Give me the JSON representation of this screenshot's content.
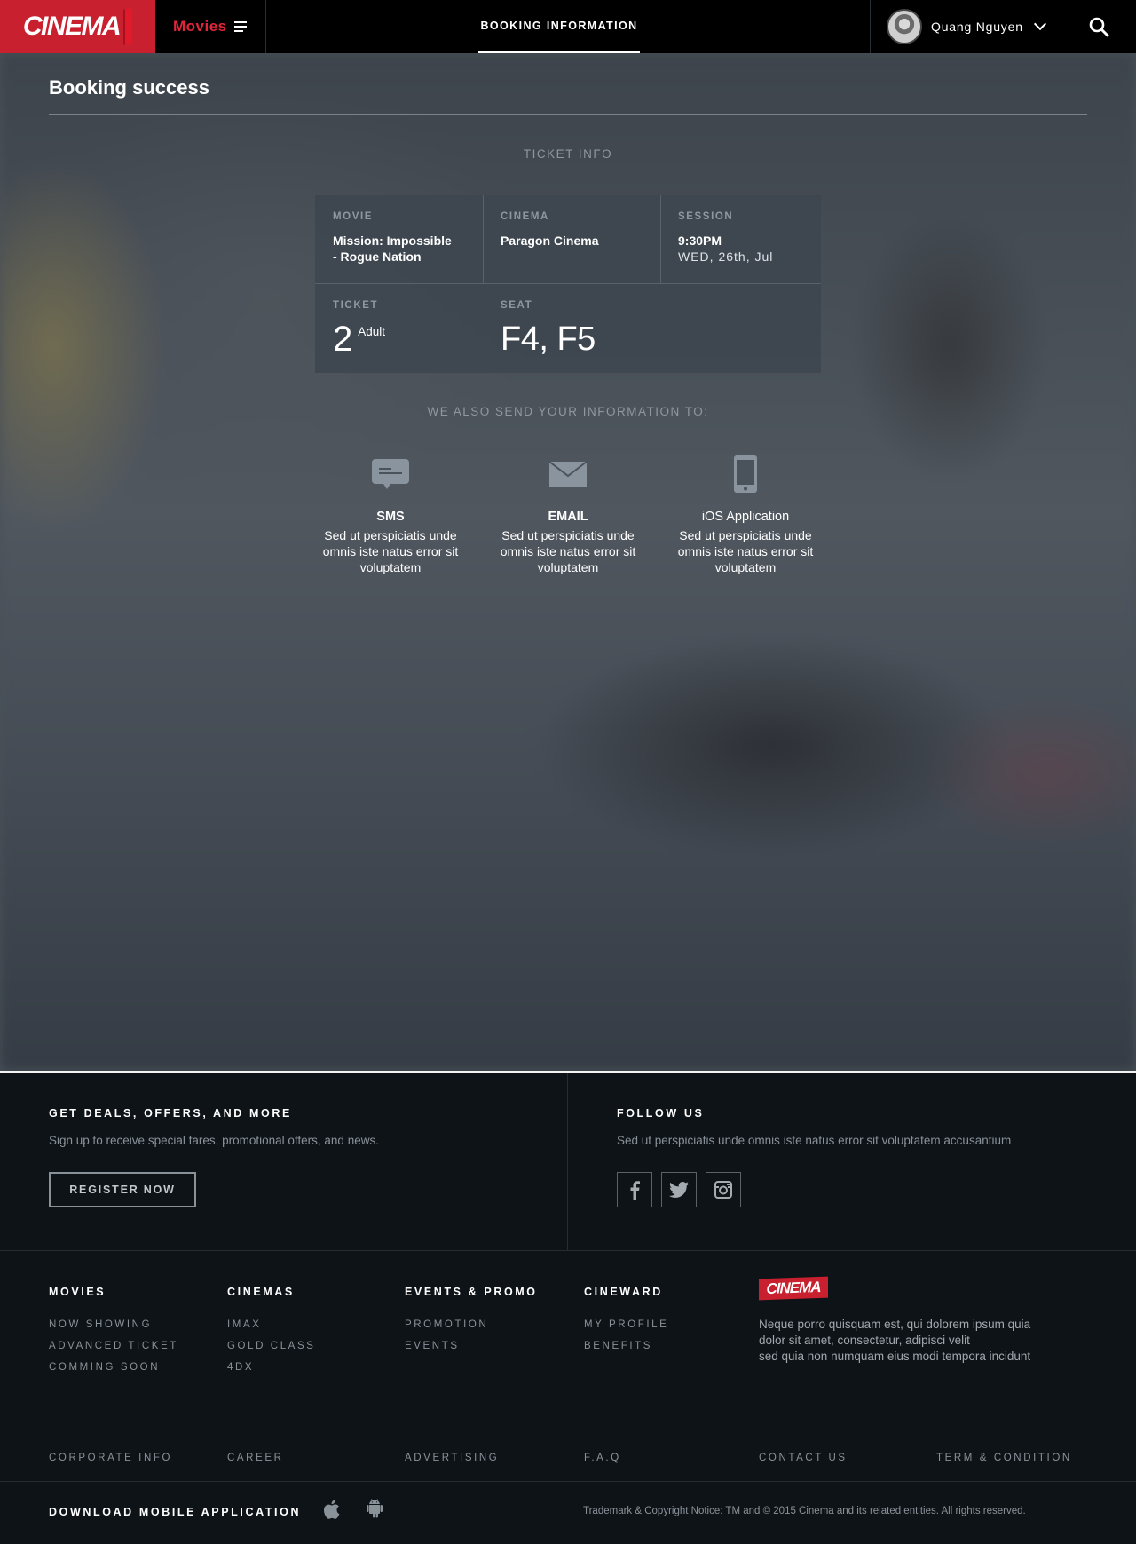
{
  "header": {
    "logo": "CINEMA",
    "menu_label": "Movies",
    "nav_tab": "BOOKING INFORMATION",
    "user_name": "Quang Nguyen"
  },
  "page": {
    "title": "Booking success",
    "ticket_info_label": "TICKET INFO",
    "also_send_label": "WE ALSO SEND YOUR INFORMATION TO:"
  },
  "ticket": {
    "movie_label": "MOVIE",
    "movie_line1": "Mission: Impossible",
    "movie_line2": "- Rogue Nation",
    "cinema_label": "CINEMA",
    "cinema_value": "Paragon Cinema",
    "session_label": "SESSION",
    "session_time": "9:30PM",
    "session_date": "WED, 26th, Jul",
    "ticket_label": "TICKET",
    "ticket_count": "2",
    "ticket_type": "Adult",
    "seat_label": "SEAT",
    "seat_value": "F4, F5"
  },
  "channels": [
    {
      "title": "SMS",
      "line1": "Sed ut perspiciatis unde",
      "line2": "omnis iste natus error sit",
      "line3": "voluptatem",
      "icon": "sms-icon"
    },
    {
      "title": "EMAIL",
      "line1": "Sed ut perspiciatis unde",
      "line2": "omnis iste natus error sit",
      "line3": "voluptatem",
      "icon": "email-icon"
    },
    {
      "title": "iOS Application",
      "line1": "Sed ut perspiciatis unde",
      "line2": "omnis iste natus error sit",
      "line3": "voluptatem",
      "icon": "phone-icon"
    }
  ],
  "footer": {
    "deals_title": "GET DEALS, OFFERS, AND MORE",
    "deals_text": "Sign up to receive special fares, promotional offers, and news.",
    "register_label": "REGISTER NOW",
    "follow_title": "FOLLOW US",
    "follow_text": "Sed ut perspiciatis unde omnis iste natus error sit voluptatem accusantium",
    "columns": [
      {
        "title": "MOVIES",
        "links": [
          "NOW SHOWING",
          "ADVANCED TICKET",
          "COMMING SOON"
        ]
      },
      {
        "title": "CINEMAS",
        "links": [
          "IMAX",
          "GOLD CLASS",
          "4DX"
        ]
      },
      {
        "title": "EVENTS & PROMO",
        "links": [
          "PROMOTION",
          "EVENTS"
        ]
      },
      {
        "title": "CINEWARD",
        "links": [
          "MY PROFILE",
          "BENEFITS"
        ]
      }
    ],
    "logo": "CINEMA",
    "about_line1": "Neque porro quisquam est, qui dolorem ipsum quia",
    "about_line2": "dolor sit amet, consectetur, adipisci velit",
    "about_line3": "sed quia non numquam eius modi tempora incidunt",
    "bottom_links": [
      "CORPORATE INFO",
      "CAREER",
      "ADVERTISING",
      "F.A.Q",
      "CONTACT US",
      "TERM & CONDITION"
    ],
    "download_title": "DOWNLOAD MOBILE APPLICATION",
    "copyright": "Trademark & Copyright Notice: TM and © 2015 Cinema and its related entities. All rights reserved."
  },
  "colors": {
    "brand": "#c8202e",
    "accent_red": "#e0253a",
    "header_bg": "#000000",
    "footer_bg": "#0e1318",
    "card_bg": "#3e464f"
  }
}
